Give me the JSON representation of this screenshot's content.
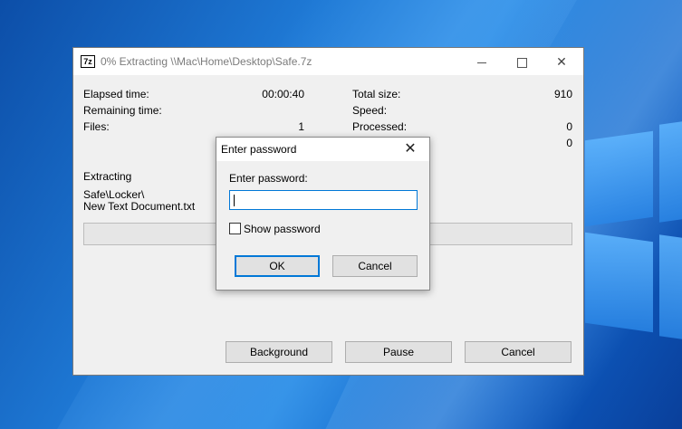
{
  "window": {
    "app_icon": "7z",
    "title": "0% Extracting \\\\Mac\\Home\\Desktop\\Safe.7z",
    "minimize_glyph": "minimize-icon",
    "close_glyph": "✕"
  },
  "stats": {
    "elapsed_label": "Elapsed time:",
    "elapsed_value": "00:00:40",
    "remaining_label": "Remaining time:",
    "files_label": "Files:",
    "files_value": "1",
    "total_size_label": "Total size:",
    "total_size_value": "910",
    "speed_label": "Speed:",
    "processed_label": "Processed:",
    "processed_value": "0",
    "extra_value": "0"
  },
  "operation": {
    "label": "Extracting",
    "path_line1": "Safe\\Locker\\",
    "path_line2": "New Text Document.txt"
  },
  "progress": {
    "percent": 0
  },
  "buttons": {
    "background": "Background",
    "pause": "Pause",
    "cancel": "Cancel"
  },
  "password_dialog": {
    "title": "Enter password",
    "close_glyph": "✕",
    "field_label": "Enter password:",
    "field_value": "",
    "show_password_label": "Show password",
    "show_password_checked": false,
    "ok_label": "OK",
    "cancel_label": "Cancel"
  },
  "colors": {
    "accent": "#0078d7",
    "desktop": "#1f7ad6"
  }
}
